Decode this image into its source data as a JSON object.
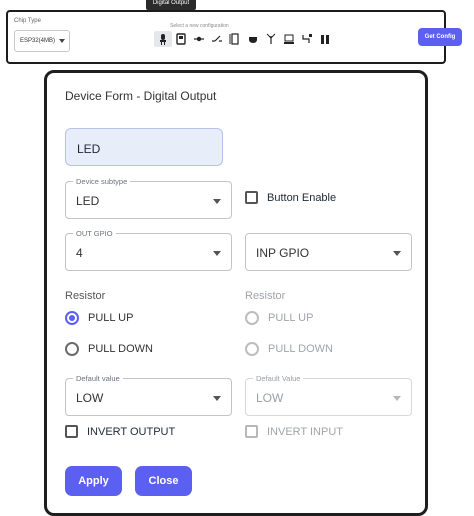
{
  "toolbar": {
    "chip_type_label": "Chip Type",
    "chip_type_value": "ESP32(4MB)",
    "tooltip": "Digital Output",
    "select_config_label": "Select a new configuration",
    "get_config_label": "Get Config",
    "device_icons": [
      "digital-output-icon",
      "digital-input-icon",
      "servo-icon",
      "switch-icon",
      "relay-icon",
      "buzzer-icon",
      "antenna-icon",
      "display-icon",
      "rgb-led-icon",
      "battery-icon"
    ]
  },
  "form": {
    "title": "Device Form - Digital Output",
    "name_value": "LED",
    "device_subtype": {
      "label": "Device subtype",
      "value": "LED"
    },
    "button_enable_label": "Button Enable",
    "out_gpio": {
      "label": "OUT GPIO",
      "value": "4"
    },
    "inp_gpio": {
      "placeholder": "INP GPIO"
    },
    "resistor_left": {
      "label": "Resistor",
      "options": [
        "PULL UP",
        "PULL DOWN"
      ],
      "selected": "PULL UP"
    },
    "resistor_right": {
      "label": "Resistor",
      "options": [
        "PULL UP",
        "PULL DOWN"
      ]
    },
    "default_value_left": {
      "label": "Default value",
      "value": "LOW"
    },
    "default_value_right": {
      "label": "Default Value",
      "value": "LOW"
    },
    "invert_output_label": "INVERT OUTPUT",
    "invert_input_label": "INVERT INPUT",
    "apply_label": "Apply",
    "close_label": "Close"
  },
  "colors": {
    "accent": "#5b5ff2",
    "name_field_bg": "#e8edfa"
  }
}
